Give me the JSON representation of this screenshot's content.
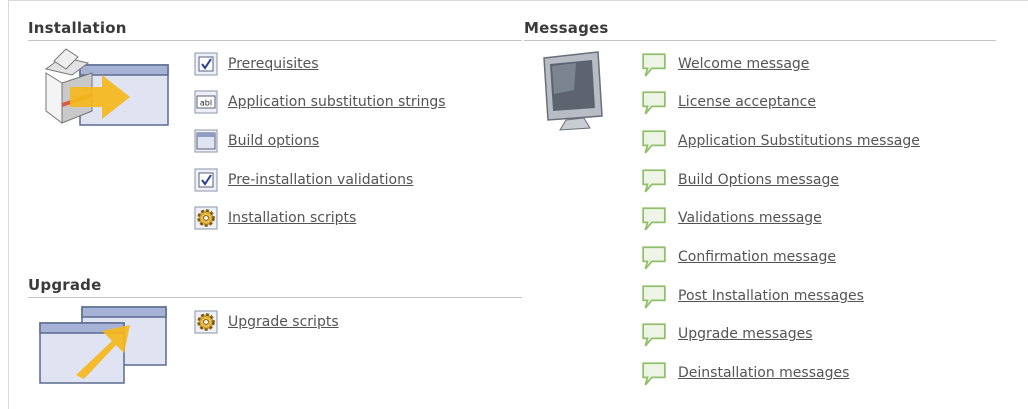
{
  "installation": {
    "title": "Installation",
    "items": [
      {
        "label": "Prerequisites",
        "icon": "checkbox-icon"
      },
      {
        "label": "Application substitution strings",
        "icon": "abl-textfield-icon"
      },
      {
        "label": "Build options",
        "icon": "window-icon"
      },
      {
        "label": "Pre-installation validations",
        "icon": "checkbox-icon"
      },
      {
        "label": "Installation scripts",
        "icon": "gear-icon"
      }
    ]
  },
  "upgrade": {
    "title": "Upgrade",
    "items": [
      {
        "label": "Upgrade scripts",
        "icon": "gear-icon"
      }
    ]
  },
  "messages": {
    "title": "Messages",
    "items": [
      {
        "label": "Welcome message",
        "icon": "speech-bubble-icon"
      },
      {
        "label": "License acceptance",
        "icon": "speech-bubble-icon"
      },
      {
        "label": "Application Substitutions message",
        "icon": "speech-bubble-icon"
      },
      {
        "label": "Build Options message",
        "icon": "speech-bubble-icon"
      },
      {
        "label": "Validations message",
        "icon": "speech-bubble-icon"
      },
      {
        "label": "Confirmation message",
        "icon": "speech-bubble-icon"
      },
      {
        "label": "Post Installation messages",
        "icon": "speech-bubble-icon"
      },
      {
        "label": "Upgrade messages",
        "icon": "speech-bubble-icon"
      },
      {
        "label": "Deinstallation messages",
        "icon": "speech-bubble-icon"
      }
    ]
  },
  "colors": {
    "link": "#545454",
    "heading": "#3a3a3a",
    "rule": "#c4c4c4",
    "bubble": "#8fbf6a",
    "arrow": "#f5b81c"
  }
}
